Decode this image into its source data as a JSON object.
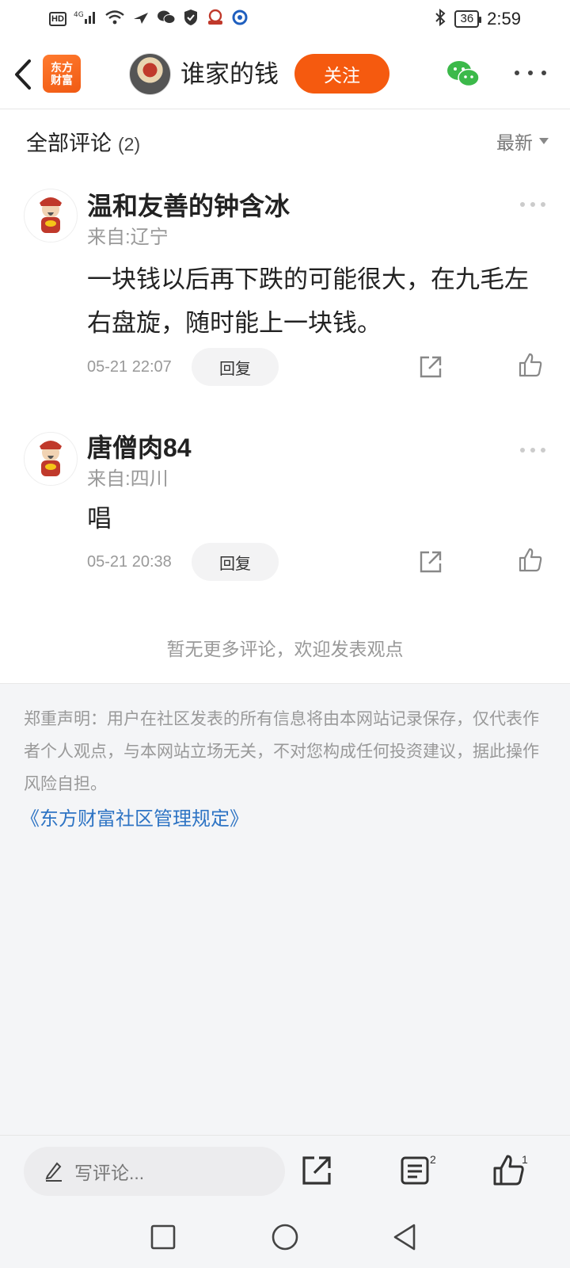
{
  "status_bar": {
    "left_icons": [
      "hd-icon",
      "4g-signal-icon",
      "wifi-icon",
      "plane-send-icon",
      "wechat-notif-icon",
      "shield-icon",
      "app-notif-icon",
      "browser-notif-icon"
    ],
    "hd_label": "HD",
    "network_label": "4G",
    "bluetooth": "bluetooth-icon",
    "battery": "36",
    "time": "2:59"
  },
  "nav": {
    "logo_text": "东方\n财富",
    "title": "谁家的钱",
    "follow_label": "关注"
  },
  "comments_header": {
    "title": "全部评论",
    "count": "(2)",
    "sort_label": "最新"
  },
  "comments": [
    {
      "author": "温和友善的钟含冰",
      "location": "来自:辽宁",
      "text": "一块钱以后再下跌的可能很大，在九毛左右盘旋，随时能上一块钱。",
      "time": "05-21 22:07",
      "reply_label": "回复"
    },
    {
      "author": "唐僧肉84",
      "location": "来自:四川",
      "text": "唱",
      "time": "05-21 20:38",
      "reply_label": "回复"
    }
  ],
  "no_more_text": "暂无更多评论，欢迎发表观点",
  "disclaimer": {
    "text": "郑重声明：用户在社区发表的所有信息将由本网站记录保存，仅代表作者个人观点，与本网站立场无关，不对您构成任何投资建议，据此操作风险自担。",
    "rules_link": "《东方财富社区管理规定》"
  },
  "bottom_bar": {
    "input_placeholder": "写评论...",
    "comment_count_badge": "2",
    "like_count_badge": "1"
  },
  "colors": {
    "accent": "#f55a0f",
    "link": "#2e74c4",
    "wechat_green": "#3cb94a",
    "muted": "#999999"
  }
}
